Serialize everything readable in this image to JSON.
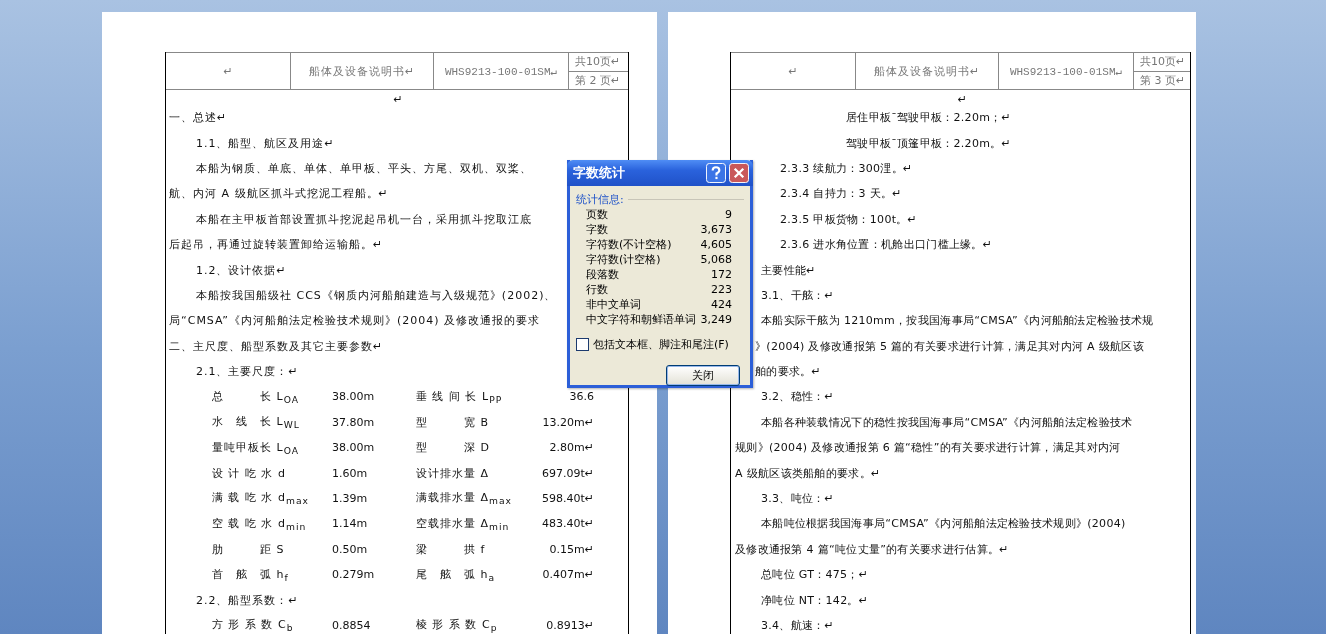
{
  "pages": [
    {
      "header": {
        "blank": "↵",
        "title": "船体及设备说明书↵",
        "code": "WHS9213-100-01SM↵",
        "total": "共10页↵",
        "page": "第 2 页↵"
      },
      "blocks": [
        {
          "kind": "center",
          "text": "↵"
        },
        {
          "kind": "flush",
          "text": "一、总述↵"
        },
        {
          "kind": "indent",
          "text": "1.1、船型、航区及用途↵"
        },
        {
          "kind": "indent",
          "text": "本船为钢质、单底、单体、单甲板、平头、方尾、双机、双桨、"
        },
        {
          "kind": "flush",
          "text": "航、内河 A 级航区抓斗式挖泥工程船。↵"
        },
        {
          "kind": "indent",
          "text": "本船在主甲板首部设置抓斗挖泥起吊机一台，采用抓斗挖取江底"
        },
        {
          "kind": "flush",
          "text": "后起吊，再通过旋转装置卸给运输船。↵"
        },
        {
          "kind": "indent",
          "text": "1.2、设计依据↵"
        },
        {
          "kind": "indent",
          "text": "本船按我国船级社 CCS《钢质内河船舶建造与入级规范》(2002)、"
        },
        {
          "kind": "flush",
          "text": "局“CMSA”《内河船舶法定检验技术规则》(2004) 及修改通报的要求"
        },
        {
          "kind": "flush",
          "text": "二、主尺度、船型系数及其它主要参数↵"
        },
        {
          "kind": "indent",
          "text": "2.1、主要尺度：↵"
        },
        {
          "kind": "params",
          "rows": [
            {
              "cells": [
                "总　　　长 L$_{OA}$",
                "38.00m",
                "垂 线 间 长 L$_{PP}$",
                "36.6"
              ]
            },
            {
              "cells": [
                "水　线　长 L$_{WL}$",
                "37.80m",
                "型　　　宽 B",
                "13.20m↵"
              ]
            },
            {
              "cells": [
                "量吨甲板长 L$_{OA}$",
                "38.00m",
                "型　　　深 D",
                "2.80m↵"
              ]
            },
            {
              "cells": [
                "设 计 吃 水 d",
                "1.60m",
                "设计排水量 Δ",
                "697.09t↵"
              ]
            },
            {
              "cells": [
                "满 载 吃 水 d$_{max}$",
                "1.39m",
                "满载排水量 Δ$_{max}$",
                "598.40t↵"
              ]
            },
            {
              "cells": [
                "空 载 吃 水 d$_{min}$",
                "1.14m",
                "空载排水量 Δ$_{min}$",
                "483.40t↵"
              ]
            },
            {
              "cells": [
                "肋　　　距 S",
                "0.50m",
                "梁　　　拱 f",
                "0.15m↵"
              ]
            },
            {
              "cells": [
                "首　舷　弧 h$_{f}$",
                "0.279m",
                "尾　舷　弧 h$_{a}$",
                "0.407m↵"
              ]
            }
          ]
        },
        {
          "kind": "indent",
          "text": "2.2、船型系数：↵"
        },
        {
          "kind": "params",
          "rows": [
            {
              "cells": [
                "方 形 系 数 C$_{b}$",
                "0.8854",
                "棱 形 系 数 C$_{p}$",
                "0.8913↵"
              ]
            }
          ]
        }
      ]
    },
    {
      "header": {
        "blank": "↵",
        "title": "船体及设备说明书↵",
        "code": "WHS9213-100-01SM↵",
        "total": "共10页↵",
        "page": "第 3 页↵"
      },
      "blocks": [
        {
          "kind": "center",
          "text": "↵"
        },
        {
          "kind": "deep",
          "text": "居住甲板¯驾驶甲板：2.20m；↵"
        },
        {
          "kind": "deep",
          "text": "驾驶甲板¯顶篷甲板：2.20m。↵"
        },
        {
          "kind": "sub",
          "text": "2.3.3 续航力：300浬。↵"
        },
        {
          "kind": "sub",
          "text": "2.3.4 自持力：3 天。↵"
        },
        {
          "kind": "sub",
          "text": "2.3.5 甲板货物：100t。↵"
        },
        {
          "kind": "sub",
          "text": "2.3.6 进水角位置：机舱出口门槛上缘。↵"
        },
        {
          "kind": "indent",
          "text": "主要性能↵"
        },
        {
          "kind": "indent",
          "text": "3.1、干舷：↵"
        },
        {
          "kind": "indent",
          "text": "本船实际干舷为 1210mm，按我国海事局“CMSA”《内河船舶法定检验技术规"
        },
        {
          "kind": "after",
          "text": "》(2004) 及修改通报第 5 篇的有关要求进行计算，满足其对内河 A 级航区该"
        },
        {
          "kind": "after",
          "text": "舶的要求。↵"
        },
        {
          "kind": "indent",
          "text": "3.2、稳性：↵"
        },
        {
          "kind": "indent",
          "text": "本船各种装载情况下的稳性按我国海事局“CMSA”《内河船舶法定检验技术"
        },
        {
          "kind": "flush",
          "text": "规则》(2004) 及修改通报第 6 篇“稳性”的有关要求进行计算，满足其对内河"
        },
        {
          "kind": "flush",
          "text": "A 级航区该类船舶的要求。↵"
        },
        {
          "kind": "indent",
          "text": "3.3、吨位：↵"
        },
        {
          "kind": "indent",
          "text": "本船吨位根据我国海事局“CMSA”《内河船舶法定检验技术规则》(2004)"
        },
        {
          "kind": "flush",
          "text": "及修改通报第 4 篇“吨位丈量”的有关要求进行估算。↵"
        },
        {
          "kind": "indent",
          "text": "总吨位 GT：475；↵"
        },
        {
          "kind": "indent",
          "text": "净吨位 NT：142。↵"
        },
        {
          "kind": "indent",
          "text": "3.4、航速：↵"
        }
      ]
    }
  ],
  "dialog": {
    "title": "字数统计",
    "section": "统计信息:",
    "stats": [
      {
        "label": "页数",
        "value": "9"
      },
      {
        "label": "字数",
        "value": "3,673"
      },
      {
        "label": "字符数(不计空格)",
        "value": "4,605"
      },
      {
        "label": "字符数(计空格)",
        "value": "5,068"
      },
      {
        "label": "段落数",
        "value": "172"
      },
      {
        "label": "行数",
        "value": "223"
      },
      {
        "label": "非中文单词",
        "value": "424"
      },
      {
        "label": "中文字符和朝鲜语单词",
        "value": "3,249"
      }
    ],
    "include": {
      "label": "包括文本框、脚注和尾注(F)",
      "checked": false
    },
    "close_button": "关闭"
  }
}
